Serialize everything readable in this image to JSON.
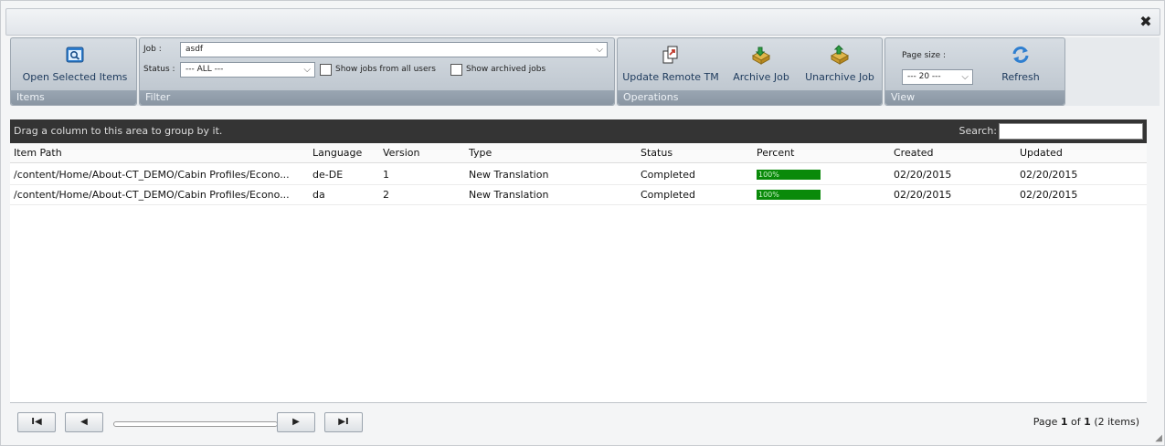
{
  "titlebar": {
    "close_symbol": "✖"
  },
  "ribbon": {
    "items_group": {
      "footer": "Items",
      "open_selected": {
        "label": "Open Selected Items",
        "icon": "magnifier-window-icon"
      }
    },
    "filter_group": {
      "footer": "Filter",
      "job_label": "Job :",
      "job_value": "asdf",
      "status_label": "Status :",
      "status_value": "--- ALL ---",
      "show_all_users": "Show jobs from all users",
      "show_archived": "Show archived jobs"
    },
    "operations_group": {
      "footer": "Operations",
      "update_remote_tm": {
        "label": "Update Remote TM",
        "icon": "update-document-icon"
      },
      "archive_job": {
        "label": "Archive Job",
        "icon": "archive-box-icon"
      },
      "unarchive_job": {
        "label": "Unarchive Job",
        "icon": "unarchive-box-icon"
      }
    },
    "view_group": {
      "footer": "View",
      "page_size_label": "Page size :",
      "page_size_value": "--- 20 ---",
      "refresh": {
        "label": "Refresh",
        "icon": "refresh-icon"
      }
    }
  },
  "grid": {
    "grouping_hint": "Drag a column to this area to group by it.",
    "search_label": "Search:",
    "search_value": "",
    "columns": [
      "Item Path",
      "Language",
      "Version",
      "Type",
      "Status",
      "Percent",
      "Created",
      "Updated"
    ],
    "rows": [
      {
        "item_path": "/content/Home/About-CT_DEMO/Cabin Profiles/Econo...",
        "language": "de-DE",
        "version": "1",
        "type": "New Translation",
        "status": "Completed",
        "percent": "100%",
        "percent_value": 1.0,
        "created": "02/20/2015",
        "updated": "02/20/2015"
      },
      {
        "item_path": "/content/Home/About-CT_DEMO/Cabin Profiles/Econo...",
        "language": "da",
        "version": "2",
        "type": "New Translation",
        "status": "Completed",
        "percent": "100%",
        "percent_value": 1.0,
        "created": "02/20/2015",
        "updated": "02/20/2015"
      }
    ]
  },
  "pager": {
    "first": "I◀",
    "prev": "◀",
    "next": "▶",
    "last": "▶I",
    "info_prefix": "Page ",
    "current": "1",
    "of": " of ",
    "total": "1",
    "items": " (2 items)"
  },
  "colors": {
    "progress": "#0a8a0a",
    "grouping_bar": "#343434"
  }
}
